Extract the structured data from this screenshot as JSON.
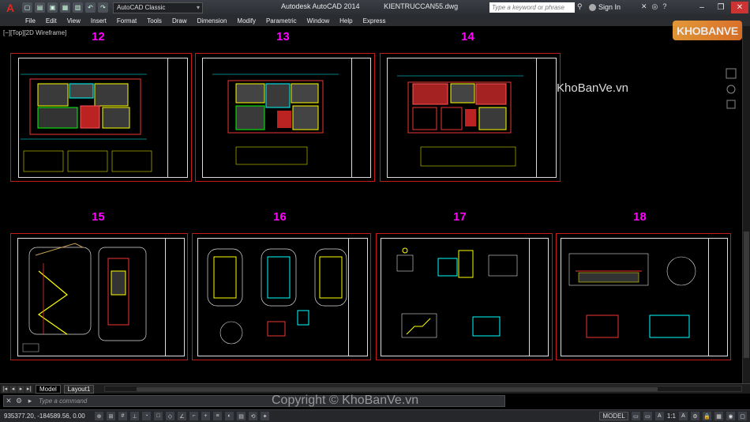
{
  "window": {
    "app_name": "Autodesk AutoCAD 2014",
    "file_name": "KIENTRUCCAN55.dwg",
    "workspace": "AutoCAD Classic",
    "search_placeholder": "Type a keyword or phrase",
    "sign_in": "Sign In"
  },
  "menu": [
    "File",
    "Edit",
    "View",
    "Insert",
    "Format",
    "Tools",
    "Draw",
    "Dimension",
    "Modify",
    "Parametric",
    "Window",
    "Help",
    "Express"
  ],
  "viewport_label": "[−][Top][2D Wireframe]",
  "sheets": [
    {
      "number": "12"
    },
    {
      "number": "13"
    },
    {
      "number": "14"
    },
    {
      "number": "15"
    },
    {
      "number": "16"
    },
    {
      "number": "17"
    },
    {
      "number": "18"
    }
  ],
  "watermark": {
    "logo": "KHOBANVE",
    "site": "KhoBanVe.vn",
    "copyright": "Copyright © KhoBanVe.vn"
  },
  "layout_tabs": [
    "Model",
    "Layout1"
  ],
  "command_line": {
    "placeholder": "Type a command"
  },
  "status": {
    "coordinates": "935377.20, -184589.56, 0.00",
    "model": "MODEL",
    "scale": "1:1"
  },
  "colors": {
    "sheet_border": "#c21b1b",
    "sheet_number": "#ff00ff",
    "canvas_bg": "#000000"
  }
}
